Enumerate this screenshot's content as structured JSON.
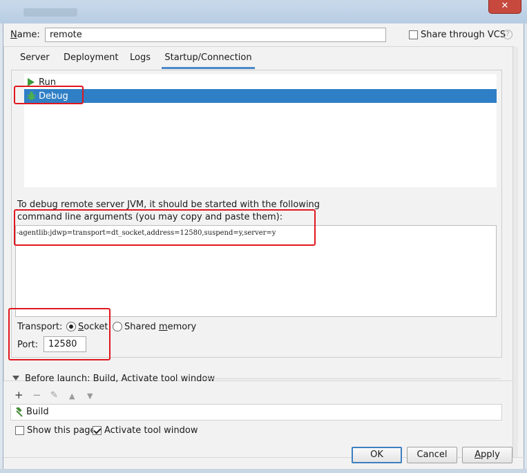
{
  "window": {
    "close_glyph": "✕"
  },
  "name": {
    "label": "Name:",
    "value": "remote"
  },
  "share_vcs": {
    "label": "Share through VCS",
    "checked": false,
    "help": "?"
  },
  "tabs": [
    {
      "label": "Server",
      "active": false
    },
    {
      "label": "Deployment",
      "active": false
    },
    {
      "label": "Logs",
      "active": false
    },
    {
      "label": "Startup/Connection",
      "active": true
    }
  ],
  "modes": [
    {
      "label": "Run",
      "icon": "run-icon",
      "selected": false
    },
    {
      "label": "Debug",
      "icon": "debug-icon",
      "selected": true
    }
  ],
  "debug_info": {
    "line1": "To debug remote server JVM, it should be started with the following",
    "line2": "command line arguments (you may copy and paste them):",
    "args": "-agentlib:jdwp=transport=dt_socket,address=12580,suspend=y,server=y"
  },
  "transport": {
    "label": "Transport:",
    "options": [
      "Socket",
      "Shared memory"
    ],
    "selected": "Socket"
  },
  "port": {
    "label": "Port:",
    "value": "12580"
  },
  "before_launch": {
    "label": "Before launch: Build, Activate tool window",
    "tools": [
      "+",
      "−",
      "✎",
      "▲",
      "▼"
    ],
    "tasks": [
      {
        "label": "Build",
        "icon": "hammer-icon"
      }
    ]
  },
  "options": {
    "show_page": "Show this page",
    "show_page_checked": false,
    "activate_tool": "Activate tool window",
    "activate_tool_checked": true
  },
  "buttons": {
    "ok": "OK",
    "cancel": "Cancel",
    "apply": "Apply"
  },
  "colors": {
    "selection": "#2f7fc6",
    "highlight": "#e0161d",
    "run_green": "#3d9a3d"
  }
}
